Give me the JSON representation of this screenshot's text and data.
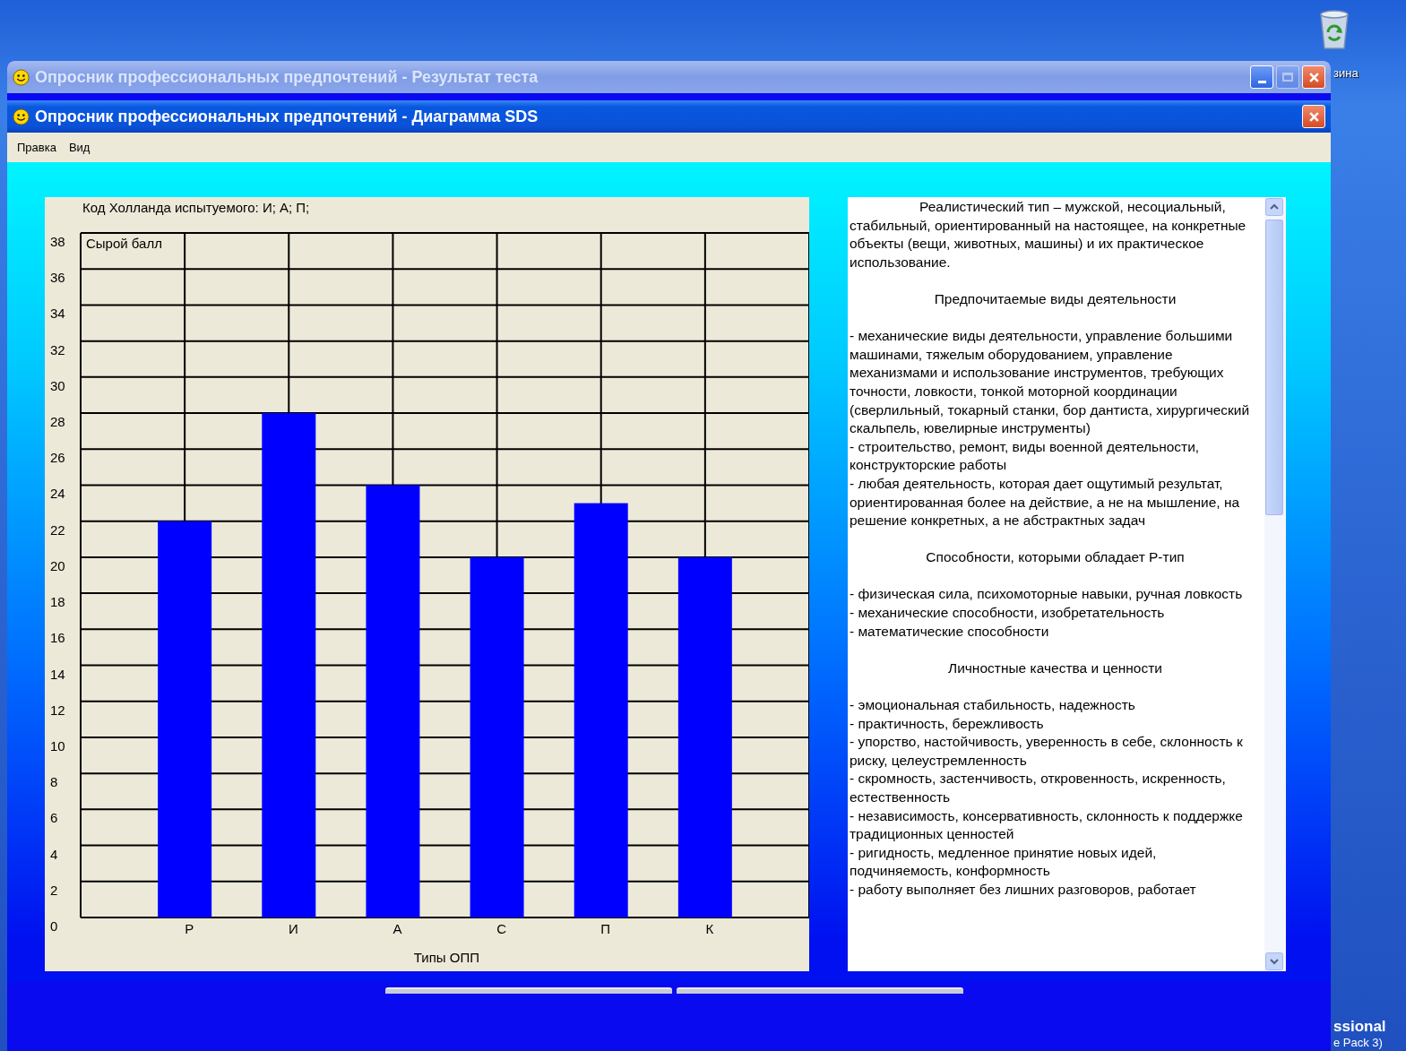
{
  "desktop": {
    "icon_label": "зина",
    "corner_lines": [
      "ssional",
      "e Pack 3)"
    ]
  },
  "back_window": {
    "title": "Опросник профессиональных предпочтений - Результат теста",
    "active": false,
    "controls": [
      {
        "kind": "minimize",
        "disabled": false
      },
      {
        "kind": "maximize",
        "disabled": true
      },
      {
        "kind": "close",
        "disabled": false
      }
    ]
  },
  "window": {
    "title": "Опросник профессиональных предпочтений - Диаграмма SDS",
    "active": true,
    "controls": [
      {
        "kind": "close",
        "disabled": false
      }
    ]
  },
  "menu": [
    "Правка",
    "Вид"
  ],
  "chart_panel": {
    "holland_code": "Код Холланда испытуемого: И; А; П;",
    "chart_data": {
      "type": "bar",
      "xlabel": "Типы ОПП",
      "ylabel": "Сырой балл",
      "categories": [
        "Р",
        "И",
        "А",
        "С",
        "П",
        "К"
      ],
      "values": [
        22,
        28,
        24,
        20,
        23,
        20
      ],
      "ylim": [
        0,
        38
      ],
      "yticks": [
        0,
        2,
        4,
        6,
        8,
        10,
        12,
        14,
        16,
        18,
        20,
        22,
        24,
        26,
        28,
        30,
        32,
        34,
        36,
        38
      ],
      "color": "#0000ff",
      "grid": true
    }
  },
  "description": {
    "intro": "Реалистический тип – мужской, несоциальный, стабильный, ориентированный на настоящее, на конкретные объекты (вещи, животных, машины) и их практическое использование.",
    "sections": [
      {
        "heading": "Предпочитаемые виды деятельности",
        "items": [
          "- механические виды деятельности, управление большими машинами, тяжелым оборудованием, управление механизмами и использование инструментов, требующих точности, ловкости, тонкой моторной координации (сверлильный, токарный станки, бор дантиста, хирургический скальпель, ювелирные инструменты)",
          "- строительство, ремонт, виды военной деятельности, конструкторские работы",
          "- любая деятельность, которая дает ощутимый результат, ориентированная более на действие, а не на мышление, на решение конкретных, а не абстрактных задач"
        ]
      },
      {
        "heading": "Способности, которыми обладает Р-тип",
        "items": [
          "- физическая сила, психомоторные навыки, ручная ловкость",
          "- механические способности, изобретательность",
          "- математические способности"
        ]
      },
      {
        "heading": "Личностные качества и ценности",
        "items": [
          "- эмоциональная стабильность, надежность",
          "- практичность, бережливость",
          "- упорство, настойчивость, уверенность в себе, склонность к риску, целеустремленность",
          "- скромность, застенчивость, откровенность, искренность, естественность",
          "- независимость, консервативность, склонность к поддержке традиционных ценностей",
          "- ригидность, медленное принятие новых идей, подчиняемость, конформность",
          "- работу выполняет без лишних разговоров, работает"
        ]
      }
    ]
  }
}
